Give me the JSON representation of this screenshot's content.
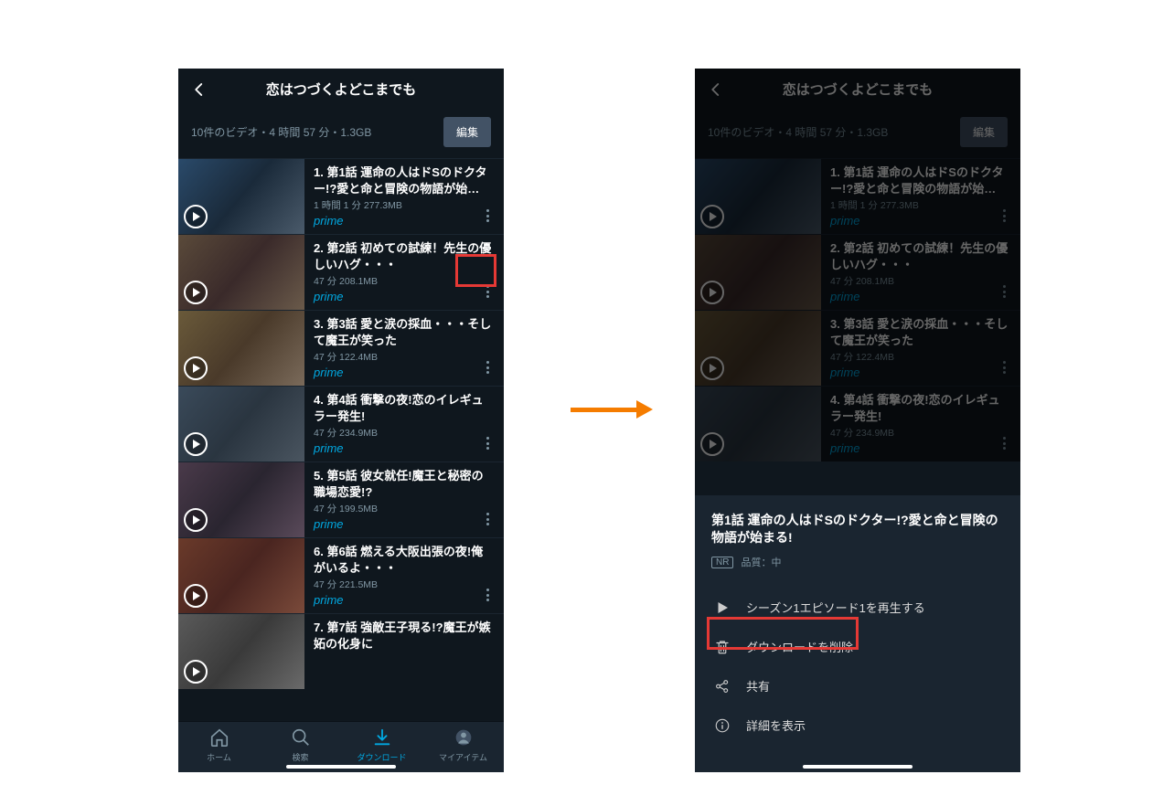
{
  "title": "恋はつづくよどこまでも",
  "infobar": "10件のビデオ・4 時間 57 分・1.3GB",
  "edit_label": "編集",
  "prime_label": "prime",
  "episodes": [
    {
      "title": "1. 第1話 運命の人はドSのドクター!?愛と命と冒険の物語が始…",
      "meta": "1 時間 1 分   277.3MB"
    },
    {
      "title": "2. 第2話 初めての試練！先生の優しいハグ・・・",
      "meta": "47 分   208.1MB"
    },
    {
      "title": "3. 第3話 愛と涙の採血・・・そして魔王が笑った",
      "meta": "47 分   122.4MB"
    },
    {
      "title": "4. 第4話 衝撃の夜!恋のイレギュラー発生!",
      "meta": "47 分   234.9MB"
    },
    {
      "title": "5. 第5話 彼女就任!魔王と秘密の職場恋愛!?",
      "meta": "47 分   199.5MB"
    },
    {
      "title": "6. 第6話 燃える大阪出張の夜!俺がいるよ・・・",
      "meta": "47 分   221.5MB"
    },
    {
      "title": "7. 第7話 強敵王子現る!?魔王が嫉妬の化身に",
      "meta": ""
    }
  ],
  "nav": {
    "home": "ホーム",
    "search": "検索",
    "download": "ダウンロード",
    "myitems": "マイアイテム"
  },
  "sheet": {
    "title": "第1話 運命の人はドSのドクター!?愛と命と冒険の物語が始まる!",
    "rating": "NR",
    "quality": "品質：中",
    "play": "シーズン1エピソード1を再生する",
    "delete": "ダウンロードを削除",
    "share": "共有",
    "details": "詳細を表示"
  }
}
